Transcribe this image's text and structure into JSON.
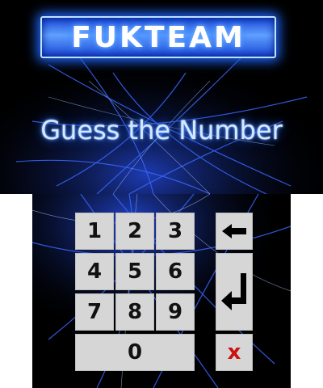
{
  "logo": {
    "text": "FUKTEAM"
  },
  "title": "Guess the Number",
  "keypad": {
    "digits": [
      "1",
      "2",
      "3",
      "4",
      "5",
      "6",
      "7",
      "8",
      "9",
      "0"
    ],
    "backspace_icon": "arrow-left-icon",
    "enter_icon": "enter-return-icon",
    "clear_label": "x"
  },
  "colors": {
    "background": "#000000",
    "glow": "#2f6bff",
    "key_face": "#d6d6d6",
    "clear": "#cc1111"
  }
}
